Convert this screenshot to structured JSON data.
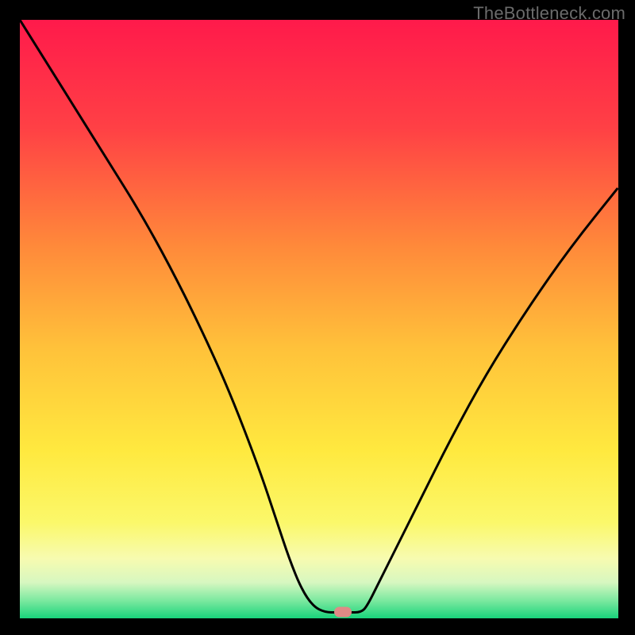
{
  "watermark": "TheBottleneck.com",
  "colors": {
    "frame": "#000000",
    "gradient_stops": [
      {
        "offset": 0.0,
        "color": "#ff1a4b"
      },
      {
        "offset": 0.18,
        "color": "#ff4045"
      },
      {
        "offset": 0.38,
        "color": "#ff8a3a"
      },
      {
        "offset": 0.55,
        "color": "#ffc23a"
      },
      {
        "offset": 0.72,
        "color": "#ffe93f"
      },
      {
        "offset": 0.84,
        "color": "#fbf86a"
      },
      {
        "offset": 0.9,
        "color": "#f7fbb0"
      },
      {
        "offset": 0.94,
        "color": "#d7f7c0"
      },
      {
        "offset": 0.97,
        "color": "#7de9a0"
      },
      {
        "offset": 1.0,
        "color": "#19d47b"
      }
    ],
    "curve_stroke": "#000000",
    "marker_fill": "#e08a86"
  },
  "chart_data": {
    "type": "line",
    "title": "",
    "xlabel": "",
    "ylabel": "",
    "xlim": [
      0,
      100
    ],
    "ylim": [
      0,
      100
    ],
    "series": [
      {
        "name": "bottleneck-curve",
        "x": [
          0,
          5,
          10,
          15,
          20,
          25,
          30,
          35,
          40,
          43,
          45,
          47,
          49,
          51,
          53,
          55,
          57,
          58,
          60,
          63,
          67,
          72,
          78,
          85,
          92,
          100
        ],
        "y": [
          100,
          92,
          84,
          76,
          68,
          59,
          49,
          38,
          25,
          16,
          10,
          5,
          2,
          1,
          1,
          1,
          1,
          2,
          6,
          12,
          20,
          30,
          41,
          52,
          62,
          72
        ]
      }
    ],
    "marker": {
      "x": 54,
      "y": 1
    },
    "grid": false,
    "legend_position": "none"
  }
}
